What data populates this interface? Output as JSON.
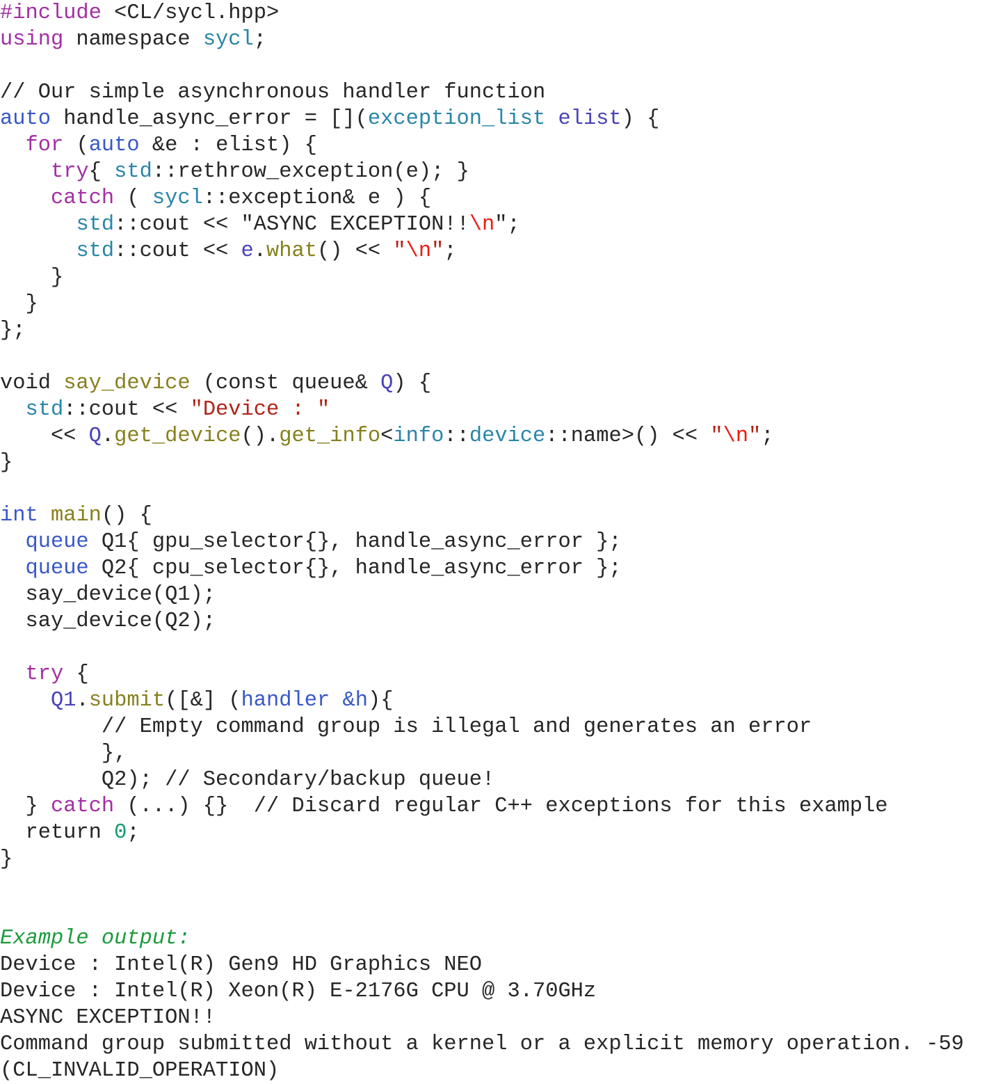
{
  "document": {
    "kind": "code-listing",
    "language": "C++ / SYCL",
    "background_color": "#ffffff",
    "palette": {
      "plain": "#262626",
      "preprocessor": "#a32fa3",
      "keyword": "#a32fa3",
      "type": "#3858c8",
      "namespace": "#2a85a8",
      "class": "#2a85a8",
      "function": "#87801e",
      "variable": "#4a42b8",
      "comment": "#262626",
      "string": "#262626",
      "string_red": "#b02418",
      "escape": "#ee1b13",
      "number": "#149a6e",
      "output_header": "#1c9b3c"
    },
    "plain_text": "#include <CL/sycl.hpp>\nusing namespace sycl;\n\n// Our simple asynchronous handler function\nauto handle_async_error = [](exception_list elist) {\n  for (auto &e : elist) {\n    try{ std::rethrow_exception(e); }\n    catch ( sycl::exception& e ) {\n      std::cout << \"ASYNC EXCEPTION!!\\n\";\n      std::cout << e.what() << \"\\n\";\n    }\n  }\n};\n\nvoid say_device (const queue& Q) {\n  std::cout << \"Device : \"\n    << Q.get_device().get_info<info::device::name>() << \"\\n\";\n}\n\nint main() {\n  queue Q1{ gpu_selector{}, handle_async_error };\n  queue Q2{ cpu_selector{}, handle_async_error };\n  say_device(Q1);\n  say_device(Q2);\n\n  try {\n    Q1.submit([&] (handler &h){\n        // Empty command group is illegal and generates an error\n        },\n        Q2); // Secondary/backup queue!\n  } catch (...) {}  // Discard regular C++ exceptions for this example\n  return 0;\n}\n\nExample output:\nDevice : Intel(R) Gen9 HD Graphics NEO\nDevice : Intel(R) Xeon(R) E-2176G CPU @ 3.70GHz\nASYNC EXCEPTION!!\nCommand group submitted without a kernel or a explicit memory operation. -59\n(CL_INVALID_OPERATION)"
  },
  "lines": [
    {
      "id": 1,
      "tokens": [
        {
          "t": "#include",
          "c": "preproc"
        },
        {
          "t": " <CL/sycl.hpp>",
          "c": "plain"
        }
      ]
    },
    {
      "id": 2,
      "tokens": [
        {
          "t": "using",
          "c": "keyword"
        },
        {
          "t": " namespace ",
          "c": "plain"
        },
        {
          "t": "sycl",
          "c": "namespace"
        },
        {
          "t": ";",
          "c": "plain"
        }
      ]
    },
    {
      "id": 3,
      "tokens": [
        {
          "t": "",
          "c": "plain"
        }
      ]
    },
    {
      "id": 4,
      "tokens": [
        {
          "t": "// Our simple asynchronous handler function",
          "c": "comment"
        }
      ]
    },
    {
      "id": 5,
      "tokens": [
        {
          "t": "auto",
          "c": "type"
        },
        {
          "t": " handle_async_error = [](",
          "c": "plain"
        },
        {
          "t": "exception_list",
          "c": "class"
        },
        {
          "t": " ",
          "c": "plain"
        },
        {
          "t": "elist",
          "c": "var"
        },
        {
          "t": ") {",
          "c": "plain"
        }
      ]
    },
    {
      "id": 6,
      "tokens": [
        {
          "t": "  ",
          "c": "plain"
        },
        {
          "t": "for",
          "c": "keyword"
        },
        {
          "t": " (",
          "c": "plain"
        },
        {
          "t": "auto",
          "c": "type"
        },
        {
          "t": " &e : elist) {",
          "c": "plain"
        }
      ]
    },
    {
      "id": 7,
      "tokens": [
        {
          "t": "    ",
          "c": "plain"
        },
        {
          "t": "try",
          "c": "keyword"
        },
        {
          "t": "{ ",
          "c": "plain"
        },
        {
          "t": "std",
          "c": "namespace"
        },
        {
          "t": "::rethrow_exception(e); }",
          "c": "plain"
        }
      ]
    },
    {
      "id": 8,
      "tokens": [
        {
          "t": "    ",
          "c": "plain"
        },
        {
          "t": "catch",
          "c": "keyword"
        },
        {
          "t": " ( ",
          "c": "plain"
        },
        {
          "t": "sycl",
          "c": "namespace"
        },
        {
          "t": "::exception& e ) {",
          "c": "plain"
        }
      ]
    },
    {
      "id": 9,
      "tokens": [
        {
          "t": "      ",
          "c": "plain"
        },
        {
          "t": "std",
          "c": "namespace"
        },
        {
          "t": "::cout << ",
          "c": "plain"
        },
        {
          "t": "\"ASYNC EXCEPTION!!",
          "c": "string"
        },
        {
          "t": "\\n",
          "c": "escape"
        },
        {
          "t": "\"",
          "c": "string"
        },
        {
          "t": ";",
          "c": "plain"
        }
      ]
    },
    {
      "id": 10,
      "tokens": [
        {
          "t": "      ",
          "c": "plain"
        },
        {
          "t": "std",
          "c": "namespace"
        },
        {
          "t": "::cout << ",
          "c": "plain"
        },
        {
          "t": "e",
          "c": "var"
        },
        {
          "t": ".",
          "c": "plain"
        },
        {
          "t": "what",
          "c": "func"
        },
        {
          "t": "() << ",
          "c": "plain"
        },
        {
          "t": "\"",
          "c": "string-red"
        },
        {
          "t": "\\n",
          "c": "escape"
        },
        {
          "t": "\"",
          "c": "string-red"
        },
        {
          "t": ";",
          "c": "plain"
        }
      ]
    },
    {
      "id": 11,
      "tokens": [
        {
          "t": "    }",
          "c": "plain"
        }
      ]
    },
    {
      "id": 12,
      "tokens": [
        {
          "t": "  }",
          "c": "plain"
        }
      ]
    },
    {
      "id": 13,
      "tokens": [
        {
          "t": "};",
          "c": "plain"
        }
      ]
    },
    {
      "id": 14,
      "tokens": [
        {
          "t": "",
          "c": "plain"
        }
      ]
    },
    {
      "id": 15,
      "tokens": [
        {
          "t": "void ",
          "c": "plain"
        },
        {
          "t": "say_device",
          "c": "func"
        },
        {
          "t": " (const queue& ",
          "c": "plain"
        },
        {
          "t": "Q",
          "c": "var"
        },
        {
          "t": ") {",
          "c": "plain"
        }
      ]
    },
    {
      "id": 16,
      "tokens": [
        {
          "t": "  ",
          "c": "plain"
        },
        {
          "t": "std",
          "c": "namespace"
        },
        {
          "t": "::cout << ",
          "c": "plain"
        },
        {
          "t": "\"Device : \"",
          "c": "string-red"
        }
      ]
    },
    {
      "id": 17,
      "tokens": [
        {
          "t": "    << ",
          "c": "plain"
        },
        {
          "t": "Q",
          "c": "var"
        },
        {
          "t": ".",
          "c": "plain"
        },
        {
          "t": "get_device",
          "c": "func"
        },
        {
          "t": "().",
          "c": "plain"
        },
        {
          "t": "get_info",
          "c": "func"
        },
        {
          "t": "<",
          "c": "plain"
        },
        {
          "t": "info",
          "c": "namespace"
        },
        {
          "t": "::",
          "c": "plain"
        },
        {
          "t": "device",
          "c": "namespace"
        },
        {
          "t": "::name>() << ",
          "c": "plain"
        },
        {
          "t": "\"",
          "c": "string-red"
        },
        {
          "t": "\\n",
          "c": "escape"
        },
        {
          "t": "\"",
          "c": "string-red"
        },
        {
          "t": ";",
          "c": "plain"
        }
      ]
    },
    {
      "id": 18,
      "tokens": [
        {
          "t": "}",
          "c": "plain"
        }
      ]
    },
    {
      "id": 19,
      "tokens": [
        {
          "t": "",
          "c": "plain"
        }
      ]
    },
    {
      "id": 20,
      "tokens": [
        {
          "t": "int",
          "c": "type"
        },
        {
          "t": " ",
          "c": "plain"
        },
        {
          "t": "main",
          "c": "func"
        },
        {
          "t": "() {",
          "c": "plain"
        }
      ]
    },
    {
      "id": 21,
      "tokens": [
        {
          "t": "  ",
          "c": "plain"
        },
        {
          "t": "queue",
          "c": "type"
        },
        {
          "t": " Q1{ gpu_selector{}, handle_async_error };",
          "c": "plain"
        }
      ]
    },
    {
      "id": 22,
      "tokens": [
        {
          "t": "  ",
          "c": "plain"
        },
        {
          "t": "queue",
          "c": "type"
        },
        {
          "t": " Q2{ cpu_selector{}, handle_async_error };",
          "c": "plain"
        }
      ]
    },
    {
      "id": 23,
      "tokens": [
        {
          "t": "  say_device(Q1);",
          "c": "plain"
        }
      ]
    },
    {
      "id": 24,
      "tokens": [
        {
          "t": "  say_device(Q2);",
          "c": "plain"
        }
      ]
    },
    {
      "id": 25,
      "tokens": [
        {
          "t": "",
          "c": "plain"
        }
      ]
    },
    {
      "id": 26,
      "tokens": [
        {
          "t": "  ",
          "c": "plain"
        },
        {
          "t": "try",
          "c": "keyword"
        },
        {
          "t": " {",
          "c": "plain"
        }
      ]
    },
    {
      "id": 27,
      "tokens": [
        {
          "t": "    ",
          "c": "plain"
        },
        {
          "t": "Q1",
          "c": "var"
        },
        {
          "t": ".",
          "c": "plain"
        },
        {
          "t": "submit",
          "c": "func"
        },
        {
          "t": "([&] (",
          "c": "plain"
        },
        {
          "t": "handler",
          "c": "type"
        },
        {
          "t": " ",
          "c": "plain"
        },
        {
          "t": "&h",
          "c": "type"
        },
        {
          "t": "){",
          "c": "plain"
        }
      ]
    },
    {
      "id": 28,
      "tokens": [
        {
          "t": "        // Empty command group is illegal and generates an error",
          "c": "comment"
        }
      ]
    },
    {
      "id": 29,
      "tokens": [
        {
          "t": "        },",
          "c": "plain"
        }
      ]
    },
    {
      "id": 30,
      "tokens": [
        {
          "t": "        Q2); ",
          "c": "plain"
        },
        {
          "t": "// Secondary/backup queue!",
          "c": "comment"
        }
      ]
    },
    {
      "id": 31,
      "tokens": [
        {
          "t": "  } ",
          "c": "plain"
        },
        {
          "t": "catch",
          "c": "keyword"
        },
        {
          "t": " (...) {}  ",
          "c": "plain"
        },
        {
          "t": "// Discard regular C++ exceptions for this example",
          "c": "comment"
        }
      ]
    },
    {
      "id": 32,
      "tokens": [
        {
          "t": "  return ",
          "c": "plain"
        },
        {
          "t": "0",
          "c": "number"
        },
        {
          "t": ";",
          "c": "plain"
        }
      ]
    },
    {
      "id": 33,
      "tokens": [
        {
          "t": "}",
          "c": "plain"
        }
      ]
    },
    {
      "id": 34,
      "tokens": [
        {
          "t": "",
          "c": "plain"
        }
      ]
    },
    {
      "id": 35,
      "tokens": [
        {
          "t": "",
          "c": "plain"
        }
      ]
    },
    {
      "id": 36,
      "tokens": [
        {
          "t": "Example output:",
          "c": "output-hdr"
        }
      ]
    },
    {
      "id": 37,
      "tokens": [
        {
          "t": "Device : Intel(R) Gen9 HD Graphics NEO",
          "c": "output"
        }
      ]
    },
    {
      "id": 38,
      "tokens": [
        {
          "t": "Device : Intel(R) Xeon(R) E-2176G CPU @ 3.70GHz",
          "c": "output"
        }
      ]
    },
    {
      "id": 39,
      "tokens": [
        {
          "t": "ASYNC EXCEPTION!!",
          "c": "output"
        }
      ]
    },
    {
      "id": 40,
      "tokens": [
        {
          "t": "Command group submitted without a kernel or a explicit memory operation. -59",
          "c": "output"
        }
      ]
    },
    {
      "id": 41,
      "tokens": [
        {
          "t": "(CL_INVALID_OPERATION)",
          "c": "output"
        }
      ]
    }
  ]
}
